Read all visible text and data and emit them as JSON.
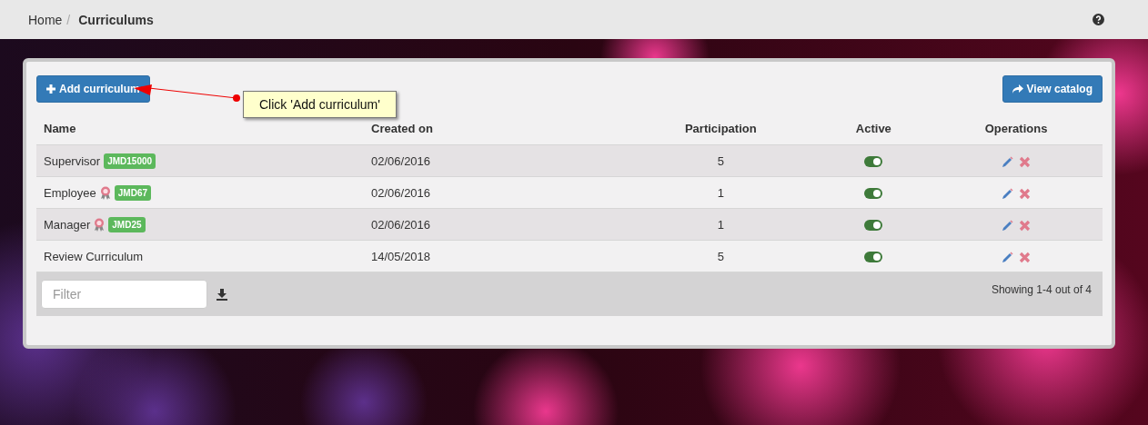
{
  "breadcrumb": [
    {
      "label": "Home",
      "current": false,
      "separator": "/"
    },
    {
      "label": "Curriculums",
      "current": true
    }
  ],
  "toolbar": {
    "add_button": "Add curriculum",
    "catalog_button": "View catalog"
  },
  "table": {
    "columns": [
      "Name",
      "Created on",
      "Participation",
      "Active",
      "Operations"
    ],
    "rows": [
      {
        "name": "Supervisor",
        "award": false,
        "code": "JMD15000",
        "created_on": "02/06/2016",
        "participation": "5",
        "active": true
      },
      {
        "name": "Employee",
        "award": true,
        "code": "JMD67",
        "created_on": "02/06/2016",
        "participation": "1",
        "active": true
      },
      {
        "name": "Manager",
        "award": true,
        "code": "JMD25",
        "created_on": "02/06/2016",
        "participation": "1",
        "active": true
      },
      {
        "name": "Review Curriculum",
        "award": false,
        "created_on": "14/05/2018",
        "participation": "5",
        "active": true
      }
    ]
  },
  "filter": {
    "placeholder": "Filter"
  },
  "status": "Showing 1-4 out of 4",
  "callout": {
    "text": "Click 'Add curriculum'"
  }
}
